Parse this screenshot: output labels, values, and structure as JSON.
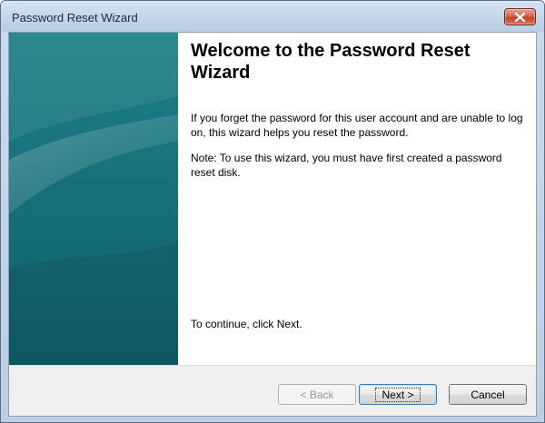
{
  "window": {
    "title": "Password Reset Wizard"
  },
  "wizard": {
    "heading": "Welcome to the Password Reset Wizard",
    "paragraph1": "If you forget the password for this user account and are unable to log on, this wizard helps you reset the password.",
    "paragraph2": "Note: To use this wizard, you must have first created a password reset disk.",
    "continue_text": "To continue, click Next."
  },
  "buttons": {
    "back_label": "< Back",
    "next_label": "Next >",
    "cancel_label": "Cancel"
  },
  "icons": {
    "close": "close-icon"
  },
  "colors": {
    "side_panel": "#17727c",
    "titlebar": "#c3d6ea",
    "close_button": "#c24128"
  }
}
